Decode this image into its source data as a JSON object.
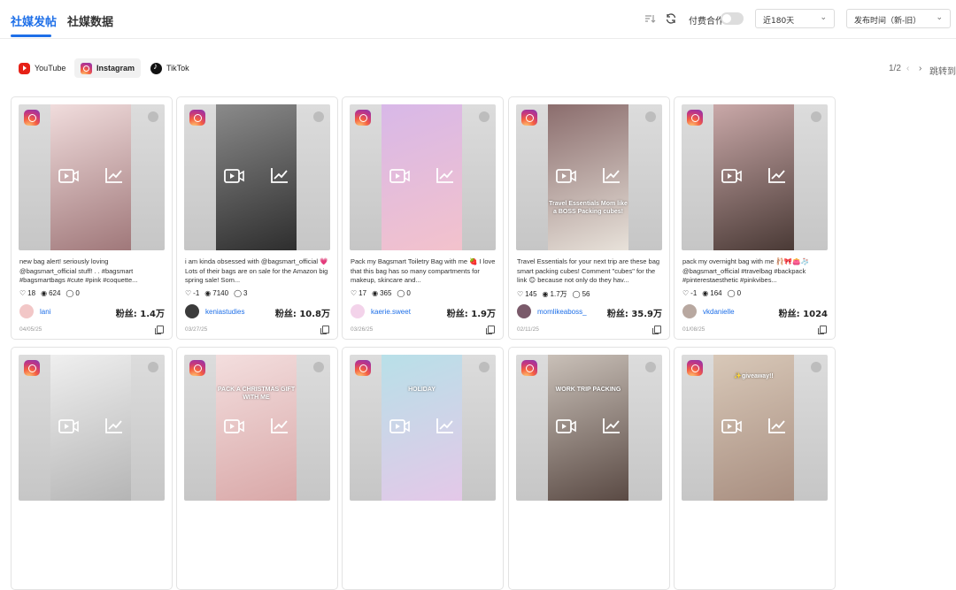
{
  "tabs": [
    {
      "label": "社媒发帖",
      "active": true
    },
    {
      "label": "社媒数据",
      "active": false
    }
  ],
  "toolbar": {
    "paid_label": "付费合作",
    "paid_enabled": false,
    "range_select": "近180天",
    "sort_select": "发布时间（新-旧）",
    "filter_icon": "sort-filter-icon",
    "refresh_icon": "refresh-icon"
  },
  "platforms": [
    {
      "label": "YouTube",
      "icon": "youtube-icon",
      "active": false
    },
    {
      "label": "Instagram",
      "icon": "instagram-icon",
      "active": true
    },
    {
      "label": "TikTok",
      "icon": "tiktok-icon",
      "active": false
    }
  ],
  "pager": {
    "page": "1/2",
    "prev": "‹",
    "next": "›",
    "jump_label": "跳转到"
  },
  "colors": {
    "accent": "#1e6fe8"
  },
  "fans_prefix": "粉丝: ",
  "posts": [
    {
      "caption": "new bag alert! seriously loving @bagsmart_official stuff! . . #bagsmart #bagsmartbags #cute #pink #coquette...",
      "likes": "18",
      "views": "624",
      "comments": "0",
      "user": "lani",
      "fans": "1.4万",
      "date": "04/05/25"
    },
    {
      "caption": "i am kinda obsessed with @bagsmart_official 💗 Lots of their bags are on sale for the Amazon big spring sale! Som...",
      "likes": "-1",
      "views": "7140",
      "comments": "3",
      "user": "keniastudies",
      "fans": "10.8万",
      "date": "03/27/25"
    },
    {
      "caption": "Pack my Bagsmart Toiletry Bag with me 🍓 I love that this bag has so many compartments for makeup, skincare and...",
      "likes": "17",
      "views": "365",
      "comments": "0",
      "user": "kaerie.sweet",
      "fans": "1.9万",
      "date": "03/26/25"
    },
    {
      "caption": "Travel Essentials for your next trip are these bag smart packing cubes! Comment \"cubes\" for the link 😊 because not only do they hav...",
      "likes": "145",
      "views": "1.7万",
      "comments": "56",
      "user": "momlikeaboss_",
      "fans": "35.9万",
      "date": "02/11/25",
      "overlay": "Travel Essentials Mom like a BOSS Packing cubes!"
    },
    {
      "caption": "pack my overnight bag with me 🩰🎀👛🧦 @bagsmart_official #travelbag #backpack #pinterestaesthetic #pinkvibes...",
      "likes": "-1",
      "views": "164",
      "comments": "0",
      "user": "vkdanielle",
      "fans": "1024",
      "date": "01/08/25"
    },
    {
      "caption": "",
      "likes": "",
      "views": "",
      "comments": "",
      "user": "",
      "fans": "",
      "date": ""
    },
    {
      "caption": "",
      "likes": "",
      "views": "",
      "comments": "",
      "user": "",
      "fans": "",
      "date": "",
      "overlay": "PACK A CHRISTMAS GIFT WITH ME"
    },
    {
      "caption": "",
      "likes": "",
      "views": "",
      "comments": "",
      "user": "",
      "fans": "",
      "date": "",
      "overlay": "HOLIDAY"
    },
    {
      "caption": "",
      "likes": "",
      "views": "",
      "comments": "",
      "user": "",
      "fans": "",
      "date": "",
      "overlay": "WORK TRIP PACKING"
    },
    {
      "caption": "",
      "likes": "",
      "views": "",
      "comments": "",
      "user": "",
      "fans": "",
      "date": "",
      "overlay": "✨giveaway!!"
    }
  ]
}
